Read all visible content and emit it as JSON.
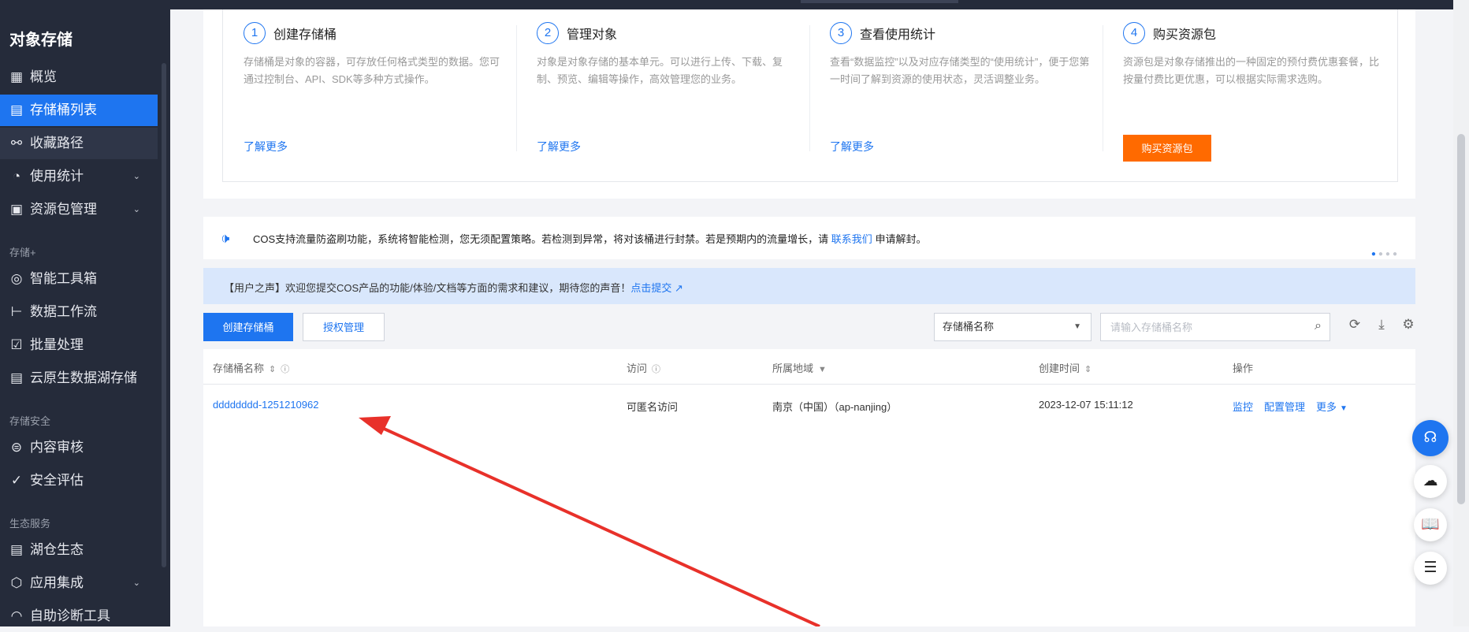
{
  "sidebar": {
    "title": "对象存储",
    "items": [
      {
        "label": "概览",
        "icon": "grid-icon"
      },
      {
        "label": "存储桶列表",
        "icon": "bucket-icon"
      },
      {
        "label": "收藏路径",
        "icon": "link-icon"
      },
      {
        "label": "使用统计",
        "icon": "pie-icon"
      },
      {
        "label": "资源包管理",
        "icon": "package-icon"
      },
      {
        "label": "智能工具箱",
        "icon": "tool-icon"
      },
      {
        "label": "数据工作流",
        "icon": "flow-icon"
      },
      {
        "label": "批量处理",
        "icon": "check-icon"
      },
      {
        "label": "云原生数据湖存储",
        "icon": "lake-icon"
      },
      {
        "label": "内容审核",
        "icon": "audit-icon"
      },
      {
        "label": "安全评估",
        "icon": "shield-icon"
      },
      {
        "label": "湖仓生态",
        "icon": "warehouse-icon"
      },
      {
        "label": "应用集成",
        "icon": "integrate-icon"
      },
      {
        "label": "自助诊断工具",
        "icon": "diagnose-icon"
      }
    ],
    "groups": {
      "storage_plus": "存储+",
      "storage_security": "存储安全",
      "ecosystem": "生态服务"
    }
  },
  "intro": {
    "steps": [
      {
        "num": "1",
        "title": "创建存储桶",
        "desc": "存储桶是对象的容器，可存放任何格式类型的数据。您可通过控制台、API、SDK等多种方式操作。",
        "more": "了解更多"
      },
      {
        "num": "2",
        "title": "管理对象",
        "desc": "对象是对象存储的基本单元。可以进行上传、下载、复制、预览、编辑等操作，高效管理您的业务。",
        "more": "了解更多"
      },
      {
        "num": "3",
        "title": "查看使用统计",
        "desc": "查看“数据监控”以及对应存储类型的“使用统计”，便于您第一时间了解到资源的使用状态，灵活调整业务。",
        "more": "了解更多"
      },
      {
        "num": "4",
        "title": "购买资源包",
        "desc": "资源包是对象存储推出的一种固定的预付费优惠套餐，比按量付费比更优惠，可以根据实际需求选购。",
        "button": "购买资源包"
      }
    ]
  },
  "notice": {
    "text": "COS支持流量防盗刷功能，系统将智能检测，您无须配置策略。若检测到异常，将对该桶进行封禁。若是预期内的流量增长，请",
    "link": "联系我们",
    "tail": "申请解封。"
  },
  "voice": {
    "text": "【用户之声】欢迎您提交COS产品的功能/体验/文档等方面的需求和建议，期待您的声音！",
    "link": "点击提交"
  },
  "toolbar": {
    "create_label": "创建存储桶",
    "auth_label": "授权管理",
    "select_value": "存储桶名称",
    "search_placeholder": "请输入存储桶名称"
  },
  "table": {
    "headers": {
      "name": "存储桶名称",
      "access": "访问",
      "region": "所属地域",
      "created": "创建时间",
      "ops": "操作"
    },
    "rows": [
      {
        "name": "dddddddd-1251210962",
        "access": "可匿名访问",
        "region": "南京（中国）（ap-nanjing）",
        "created": "2023-12-07 15:11:12",
        "op1": "监控",
        "op2": "配置管理",
        "op3": "更多"
      }
    ]
  },
  "colors": {
    "accent": "#1e75f0",
    "sidebar": "#252b3a",
    "buy": "#ff6a00",
    "arrow": "#e8312a"
  }
}
